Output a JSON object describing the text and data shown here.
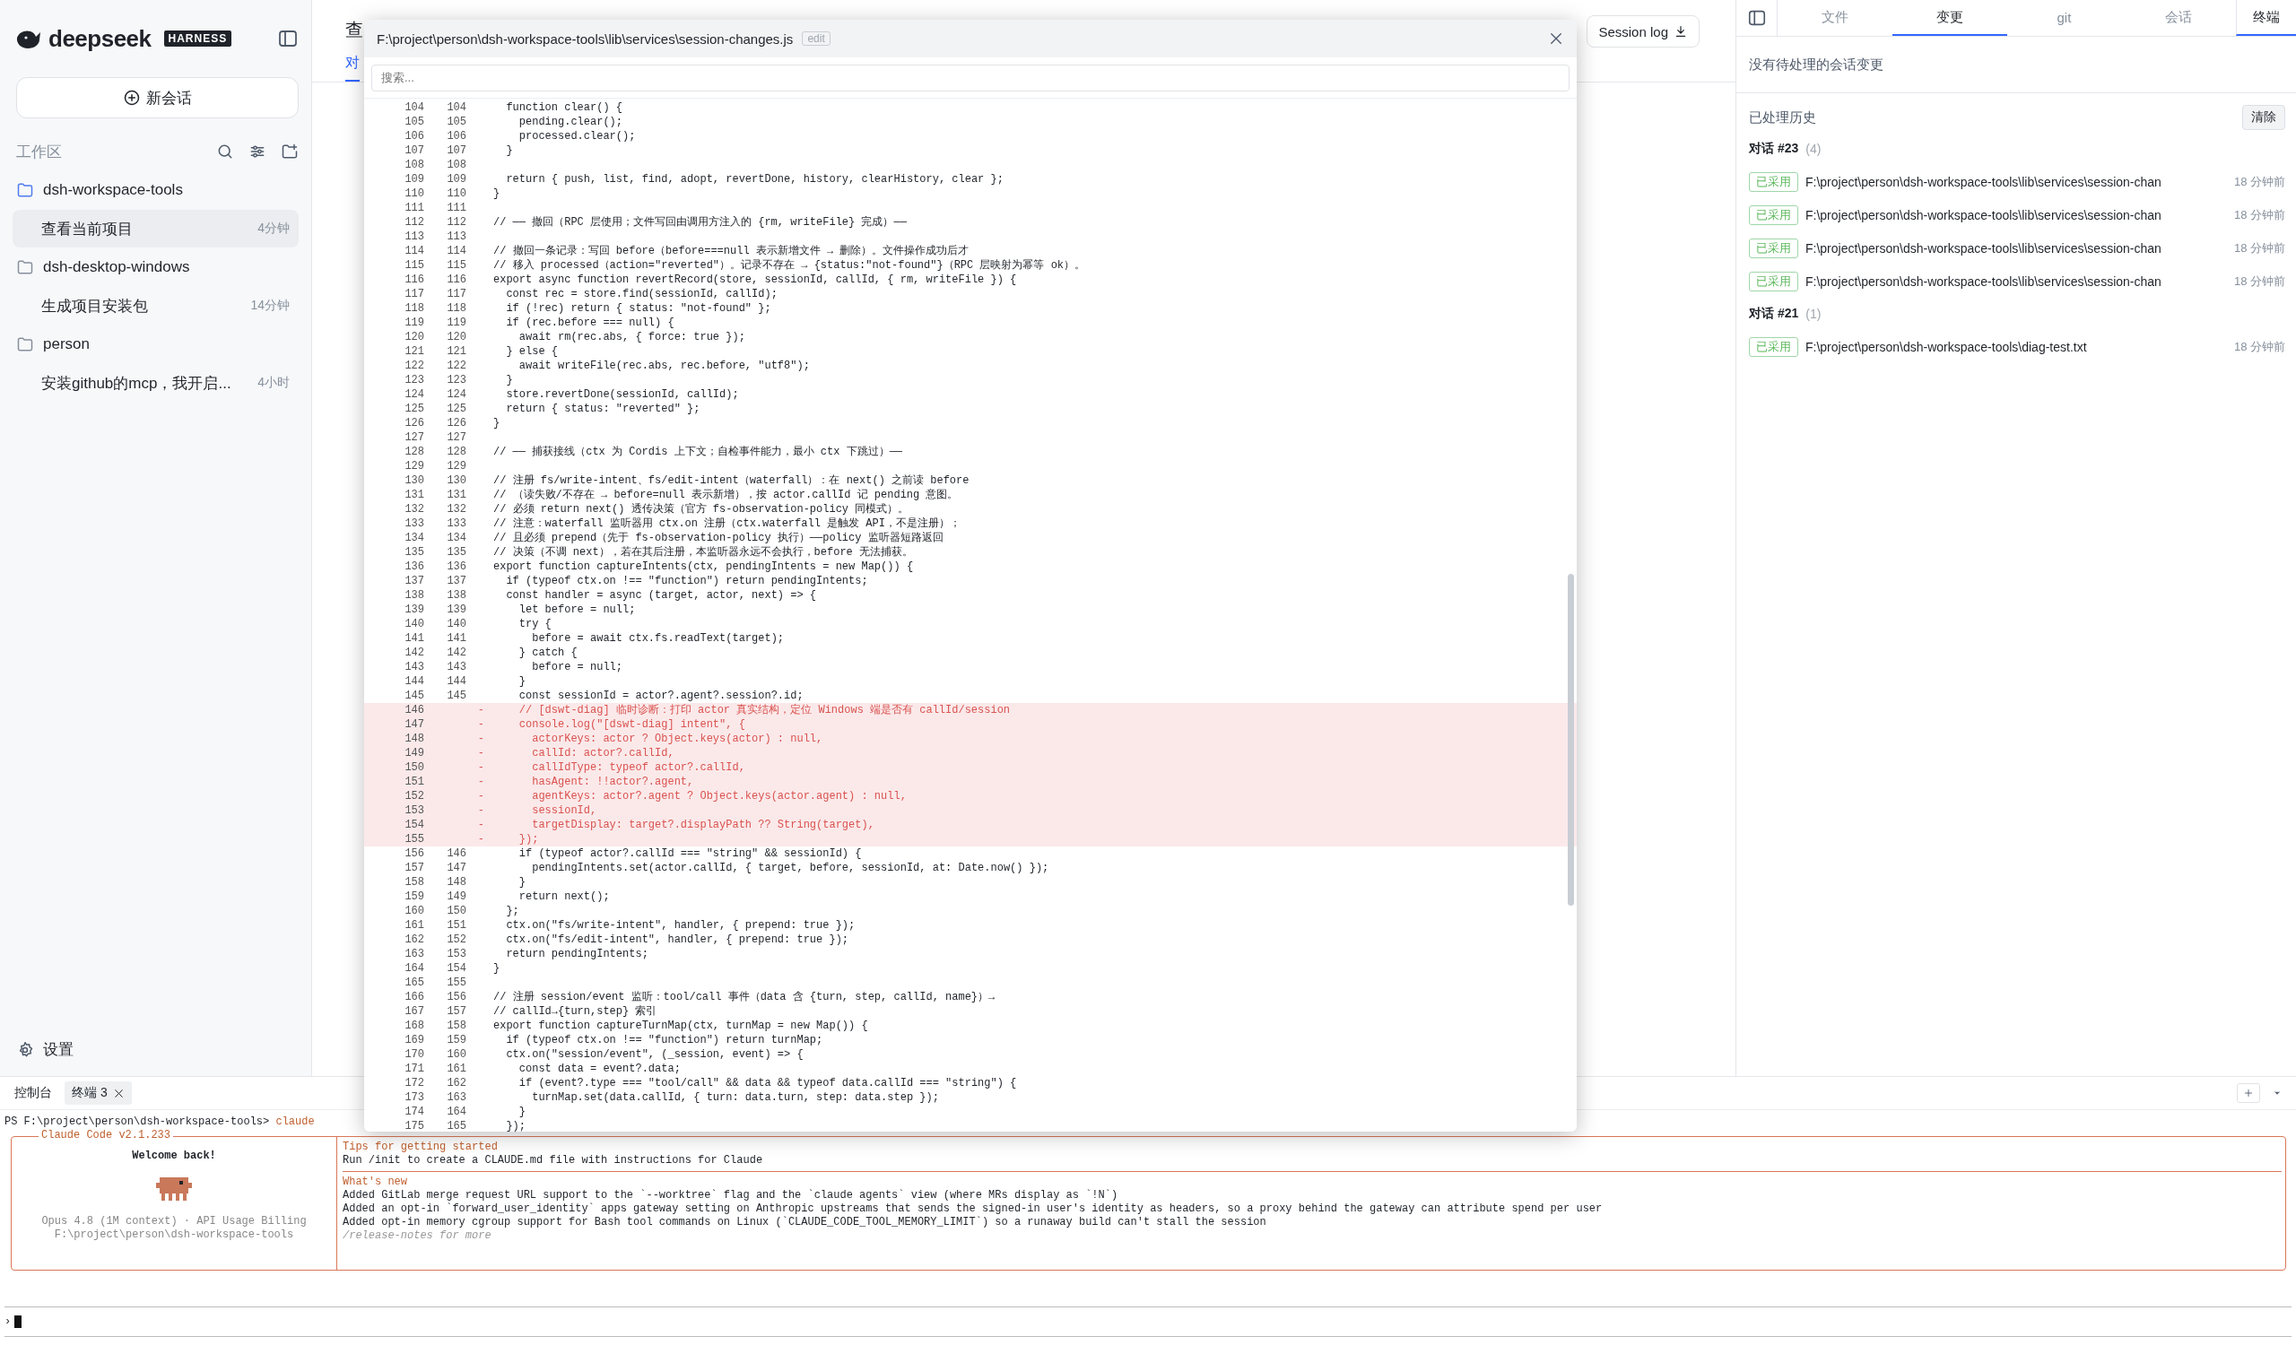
{
  "sidebar": {
    "brand": "deepseek",
    "badge": "HARNESS",
    "new_chat": "新会话",
    "workspace_label": "工作区",
    "projects": [
      {
        "name": "dsh-workspace-tools",
        "active": true,
        "children": [
          {
            "title": "查看当前项目",
            "time": "4分钟",
            "selected": true
          }
        ]
      },
      {
        "name": "dsh-desktop-windows",
        "active": false,
        "children": [
          {
            "title": "生成项目安装包",
            "time": "14分钟",
            "selected": false
          }
        ]
      },
      {
        "name": "person",
        "active": false,
        "children": [
          {
            "title": "安装github的mcp，我开启...",
            "time": "4小时",
            "selected": false
          }
        ]
      }
    ],
    "settings": "设置"
  },
  "main": {
    "title": "查",
    "tabs": [
      {
        "label": "对",
        "selected": true
      }
    ],
    "session_log_button": "Session log"
  },
  "file_viewer": {
    "path": "F:\\project\\person\\dsh-workspace-tools\\lib\\services\\session-changes.js",
    "badge": "edit",
    "search_placeholder": "搜索...",
    "lines": [
      {
        "kind": "context",
        "old": "104",
        "new": "104",
        "text": "  function clear() {"
      },
      {
        "kind": "context",
        "old": "105",
        "new": "105",
        "text": "    pending.clear();"
      },
      {
        "kind": "context",
        "old": "106",
        "new": "106",
        "text": "    processed.clear();"
      },
      {
        "kind": "context",
        "old": "107",
        "new": "107",
        "text": "  }"
      },
      {
        "kind": "context",
        "old": "108",
        "new": "108"
      },
      {
        "kind": "context",
        "old": "109",
        "new": "109",
        "text": "  return { push, list, find, adopt, revertDone, history, clearHistory, clear };"
      },
      {
        "kind": "context",
        "old": "110",
        "new": "110",
        "text": "}"
      },
      {
        "kind": "context",
        "old": "111",
        "new": "111"
      },
      {
        "kind": "context",
        "old": "112",
        "new": "112",
        "text": "// —— 撤回（RPC 层使用；文件写回由调用方注入的 {rm, writeFile} 完成）——"
      },
      {
        "kind": "context",
        "old": "113",
        "new": "113"
      },
      {
        "kind": "context",
        "old": "114",
        "new": "114",
        "text": "// 撤回一条记录：写回 before（before===null 表示新增文件 → 删除）。文件操作成功后才"
      },
      {
        "kind": "context",
        "old": "115",
        "new": "115",
        "text": "// 移入 processed（action=\"reverted\"）。记录不存在 → {status:\"not-found\"}（RPC 层映射为幂等 ok）。"
      },
      {
        "kind": "context",
        "old": "116",
        "new": "116",
        "text": "export async function revertRecord(store, sessionId, callId, { rm, writeFile }) {"
      },
      {
        "kind": "context",
        "old": "117",
        "new": "117",
        "text": "  const rec = store.find(sessionId, callId);"
      },
      {
        "kind": "context",
        "old": "118",
        "new": "118",
        "text": "  if (!rec) return { status: \"not-found\" };"
      },
      {
        "kind": "context",
        "old": "119",
        "new": "119",
        "text": "  if (rec.before === null) {"
      },
      {
        "kind": "context",
        "old": "120",
        "new": "120",
        "text": "    await rm(rec.abs, { force: true });"
      },
      {
        "kind": "context",
        "old": "121",
        "new": "121",
        "text": "  } else {"
      },
      {
        "kind": "context",
        "old": "122",
        "new": "122",
        "text": "    await writeFile(rec.abs, rec.before, \"utf8\");"
      },
      {
        "kind": "context",
        "old": "123",
        "new": "123",
        "text": "  }"
      },
      {
        "kind": "context",
        "old": "124",
        "new": "124",
        "text": "  store.revertDone(sessionId, callId);"
      },
      {
        "kind": "context",
        "old": "125",
        "new": "125",
        "text": "  return { status: \"reverted\" };"
      },
      {
        "kind": "context",
        "old": "126",
        "new": "126",
        "text": "}"
      },
      {
        "kind": "context",
        "old": "127",
        "new": "127"
      },
      {
        "kind": "context",
        "old": "128",
        "new": "128",
        "text": "// —— 捕获接线（ctx 为 Cordis 上下文；自检事件能力，最小 ctx 下跳过）——"
      },
      {
        "kind": "context",
        "old": "129",
        "new": "129"
      },
      {
        "kind": "context",
        "old": "130",
        "new": "130",
        "text": "// 注册 fs/write-intent、fs/edit-intent（waterfall）：在 next() 之前读 before"
      },
      {
        "kind": "context",
        "old": "131",
        "new": "131",
        "text": "// （读失败/不存在 → before=null 表示新增），按 actor.callId 记 pending 意图。"
      },
      {
        "kind": "context",
        "old": "132",
        "new": "132",
        "text": "// 必须 return next() 透传决策（官方 fs-observation-policy 同模式）。"
      },
      {
        "kind": "context",
        "old": "133",
        "new": "133",
        "text": "// 注意：waterfall 监听器用 ctx.on 注册（ctx.waterfall 是触发 API，不是注册）；"
      },
      {
        "kind": "context",
        "old": "134",
        "new": "134",
        "text": "// 且必须 prepend（先于 fs-observation-policy 执行）——policy 监听器短路返回"
      },
      {
        "kind": "context",
        "old": "135",
        "new": "135",
        "text": "// 决策（不调 next），若在其后注册，本监听器永远不会执行，before 无法捕获。"
      },
      {
        "kind": "context",
        "old": "136",
        "new": "136",
        "text": "export function captureIntents(ctx, pendingIntents = new Map()) {"
      },
      {
        "kind": "context",
        "old": "137",
        "new": "137",
        "text": "  if (typeof ctx.on !== \"function\") return pendingIntents;"
      },
      {
        "kind": "context",
        "old": "138",
        "new": "138",
        "text": "  const handler = async (target, actor, next) => {"
      },
      {
        "kind": "context",
        "old": "139",
        "new": "139",
        "text": "    let before = null;"
      },
      {
        "kind": "context",
        "old": "140",
        "new": "140",
        "text": "    try {"
      },
      {
        "kind": "context",
        "old": "141",
        "new": "141",
        "text": "      before = await ctx.fs.readText(target);"
      },
      {
        "kind": "context",
        "old": "142",
        "new": "142",
        "text": "    } catch {"
      },
      {
        "kind": "context",
        "old": "143",
        "new": "143",
        "text": "      before = null;"
      },
      {
        "kind": "context",
        "old": "144",
        "new": "144",
        "text": "    }"
      },
      {
        "kind": "context",
        "old": "145",
        "new": "145",
        "text": "    const sessionId = actor?.agent?.session?.id;"
      },
      {
        "kind": "removed",
        "old": "146",
        "marker": "-",
        "text": "    // [dswt-diag] 临时诊断：打印 actor 真实结构，定位 Windows 端是否有 callId/session"
      },
      {
        "kind": "removed",
        "old": "147",
        "marker": "-",
        "text": "    console.log(\"[dswt-diag] intent\", {"
      },
      {
        "kind": "removed",
        "old": "148",
        "marker": "-",
        "text": "      actorKeys: actor ? Object.keys(actor) : null,"
      },
      {
        "kind": "removed",
        "old": "149",
        "marker": "-",
        "text": "      callId: actor?.callId,"
      },
      {
        "kind": "removed",
        "old": "150",
        "marker": "-",
        "text": "      callIdType: typeof actor?.callId,"
      },
      {
        "kind": "removed",
        "old": "151",
        "marker": "-",
        "text": "      hasAgent: !!actor?.agent,"
      },
      {
        "kind": "removed",
        "old": "152",
        "marker": "-",
        "text": "      agentKeys: actor?.agent ? Object.keys(actor.agent) : null,"
      },
      {
        "kind": "removed",
        "old": "153",
        "marker": "-",
        "text": "      sessionId,"
      },
      {
        "kind": "removed",
        "old": "154",
        "marker": "-",
        "text": "      targetDisplay: target?.displayPath ?? String(target),"
      },
      {
        "kind": "removed",
        "old": "155",
        "marker": "-",
        "text": "    });"
      },
      {
        "kind": "context",
        "old": "156",
        "new": "146",
        "text": "    if (typeof actor?.callId === \"string\" && sessionId) {"
      },
      {
        "kind": "context",
        "old": "157",
        "new": "147",
        "text": "      pendingIntents.set(actor.callId, { target, before, sessionId, at: Date.now() });"
      },
      {
        "kind": "context",
        "old": "158",
        "new": "148",
        "text": "    }"
      },
      {
        "kind": "context",
        "old": "159",
        "new": "149",
        "text": "    return next();"
      },
      {
        "kind": "context",
        "old": "160",
        "new": "150",
        "text": "  };"
      },
      {
        "kind": "context",
        "old": "161",
        "new": "151",
        "text": "  ctx.on(\"fs/write-intent\", handler, { prepend: true });"
      },
      {
        "kind": "context",
        "old": "162",
        "new": "152",
        "text": "  ctx.on(\"fs/edit-intent\", handler, { prepend: true });"
      },
      {
        "kind": "context",
        "old": "163",
        "new": "153",
        "text": "  return pendingIntents;"
      },
      {
        "kind": "context",
        "old": "164",
        "new": "154",
        "text": "}"
      },
      {
        "kind": "context",
        "old": "165",
        "new": "155"
      },
      {
        "kind": "context",
        "old": "166",
        "new": "156",
        "text": "// 注册 session/event 监听：tool/call 事件（data 含 {turn, step, callId, name}）→"
      },
      {
        "kind": "context",
        "old": "167",
        "new": "157",
        "text": "// callId→{turn,step} 索引"
      },
      {
        "kind": "context",
        "old": "168",
        "new": "158",
        "text": "export function captureTurnMap(ctx, turnMap = new Map()) {"
      },
      {
        "kind": "context",
        "old": "169",
        "new": "159",
        "text": "  if (typeof ctx.on !== \"function\") return turnMap;"
      },
      {
        "kind": "context",
        "old": "170",
        "new": "160",
        "text": "  ctx.on(\"session/event\", (_session, event) => {"
      },
      {
        "kind": "context",
        "old": "171",
        "new": "161",
        "text": "    const data = event?.data;"
      },
      {
        "kind": "context",
        "old": "172",
        "new": "162",
        "text": "    if (event?.type === \"tool/call\" && data && typeof data.callId === \"string\") {"
      },
      {
        "kind": "context",
        "old": "173",
        "new": "163",
        "text": "      turnMap.set(data.callId, { turn: data.turn, step: data.step });"
      },
      {
        "kind": "context",
        "old": "174",
        "new": "164",
        "text": "    }"
      },
      {
        "kind": "context",
        "old": "175",
        "new": "165",
        "text": "  });"
      }
    ]
  },
  "changes_panel": {
    "tabs": [
      {
        "label": "文件",
        "selected": false
      },
      {
        "label": "变更",
        "selected": true
      },
      {
        "label": "git",
        "selected": false
      },
      {
        "label": "会话",
        "selected": false
      },
      {
        "label": "终端",
        "selected": true
      }
    ],
    "empty_message": "没有待处理的会话变更",
    "history_label": "已处理历史",
    "clear_button": "清除",
    "groups": [
      {
        "title": "对话 #23",
        "count": "(4)",
        "items": [
          {
            "status": "已采用",
            "path": "F:\\project\\person\\dsh-workspace-tools\\lib\\services\\session-chan",
            "time": "18 分钟前"
          },
          {
            "status": "已采用",
            "path": "F:\\project\\person\\dsh-workspace-tools\\lib\\services\\session-chan",
            "time": "18 分钟前"
          },
          {
            "status": "已采用",
            "path": "F:\\project\\person\\dsh-workspace-tools\\lib\\services\\session-chan",
            "time": "18 分钟前"
          },
          {
            "status": "已采用",
            "path": "F:\\project\\person\\dsh-workspace-tools\\lib\\services\\session-chan",
            "time": "18 分钟前"
          }
        ]
      },
      {
        "title": "对话 #21",
        "count": "(1)",
        "items": [
          {
            "status": "已采用",
            "path": "F:\\project\\person\\dsh-workspace-tools\\diag-test.txt",
            "time": "18 分钟前"
          }
        ]
      }
    ]
  },
  "terminal": {
    "tabs": [
      {
        "label": "控制台",
        "selected": false,
        "closable": false
      },
      {
        "label": "终端 3",
        "selected": true,
        "closable": true
      }
    ],
    "prompt": "PS F:\\project\\person\\dsh-workspace-tools>",
    "command": "claude",
    "banner": {
      "title": "Claude Code v2.1.233",
      "welcome": "Welcome back!",
      "model": "Opus 4.8 (1M context) · API Usage Billing",
      "cwd": "F:\\project\\person\\dsh-workspace-tools",
      "tips_heading": "Tips for getting started",
      "tips_text": "Run /init to create a CLAUDE.md file with instructions for Claude",
      "news_heading": "What's new",
      "news": [
        "Added GitLab merge request URL support to the `--worktree` flag and the `claude agents` view (where MRs display as `!N`)",
        "Added an opt-in `forward_user_identity` apps gateway setting on Anthropic upstreams that sends the signed-in user's identity as headers, so a proxy behind the gateway can attribute spend per user",
        "Added opt-in memory cgroup support for Bash tool commands on Linux (`CLAUDE_CODE_TOOL_MEMORY_LIMIT`) so a runaway build can't stall the session"
      ],
      "footer": "/release-notes for more"
    },
    "input_prompt": "›"
  }
}
